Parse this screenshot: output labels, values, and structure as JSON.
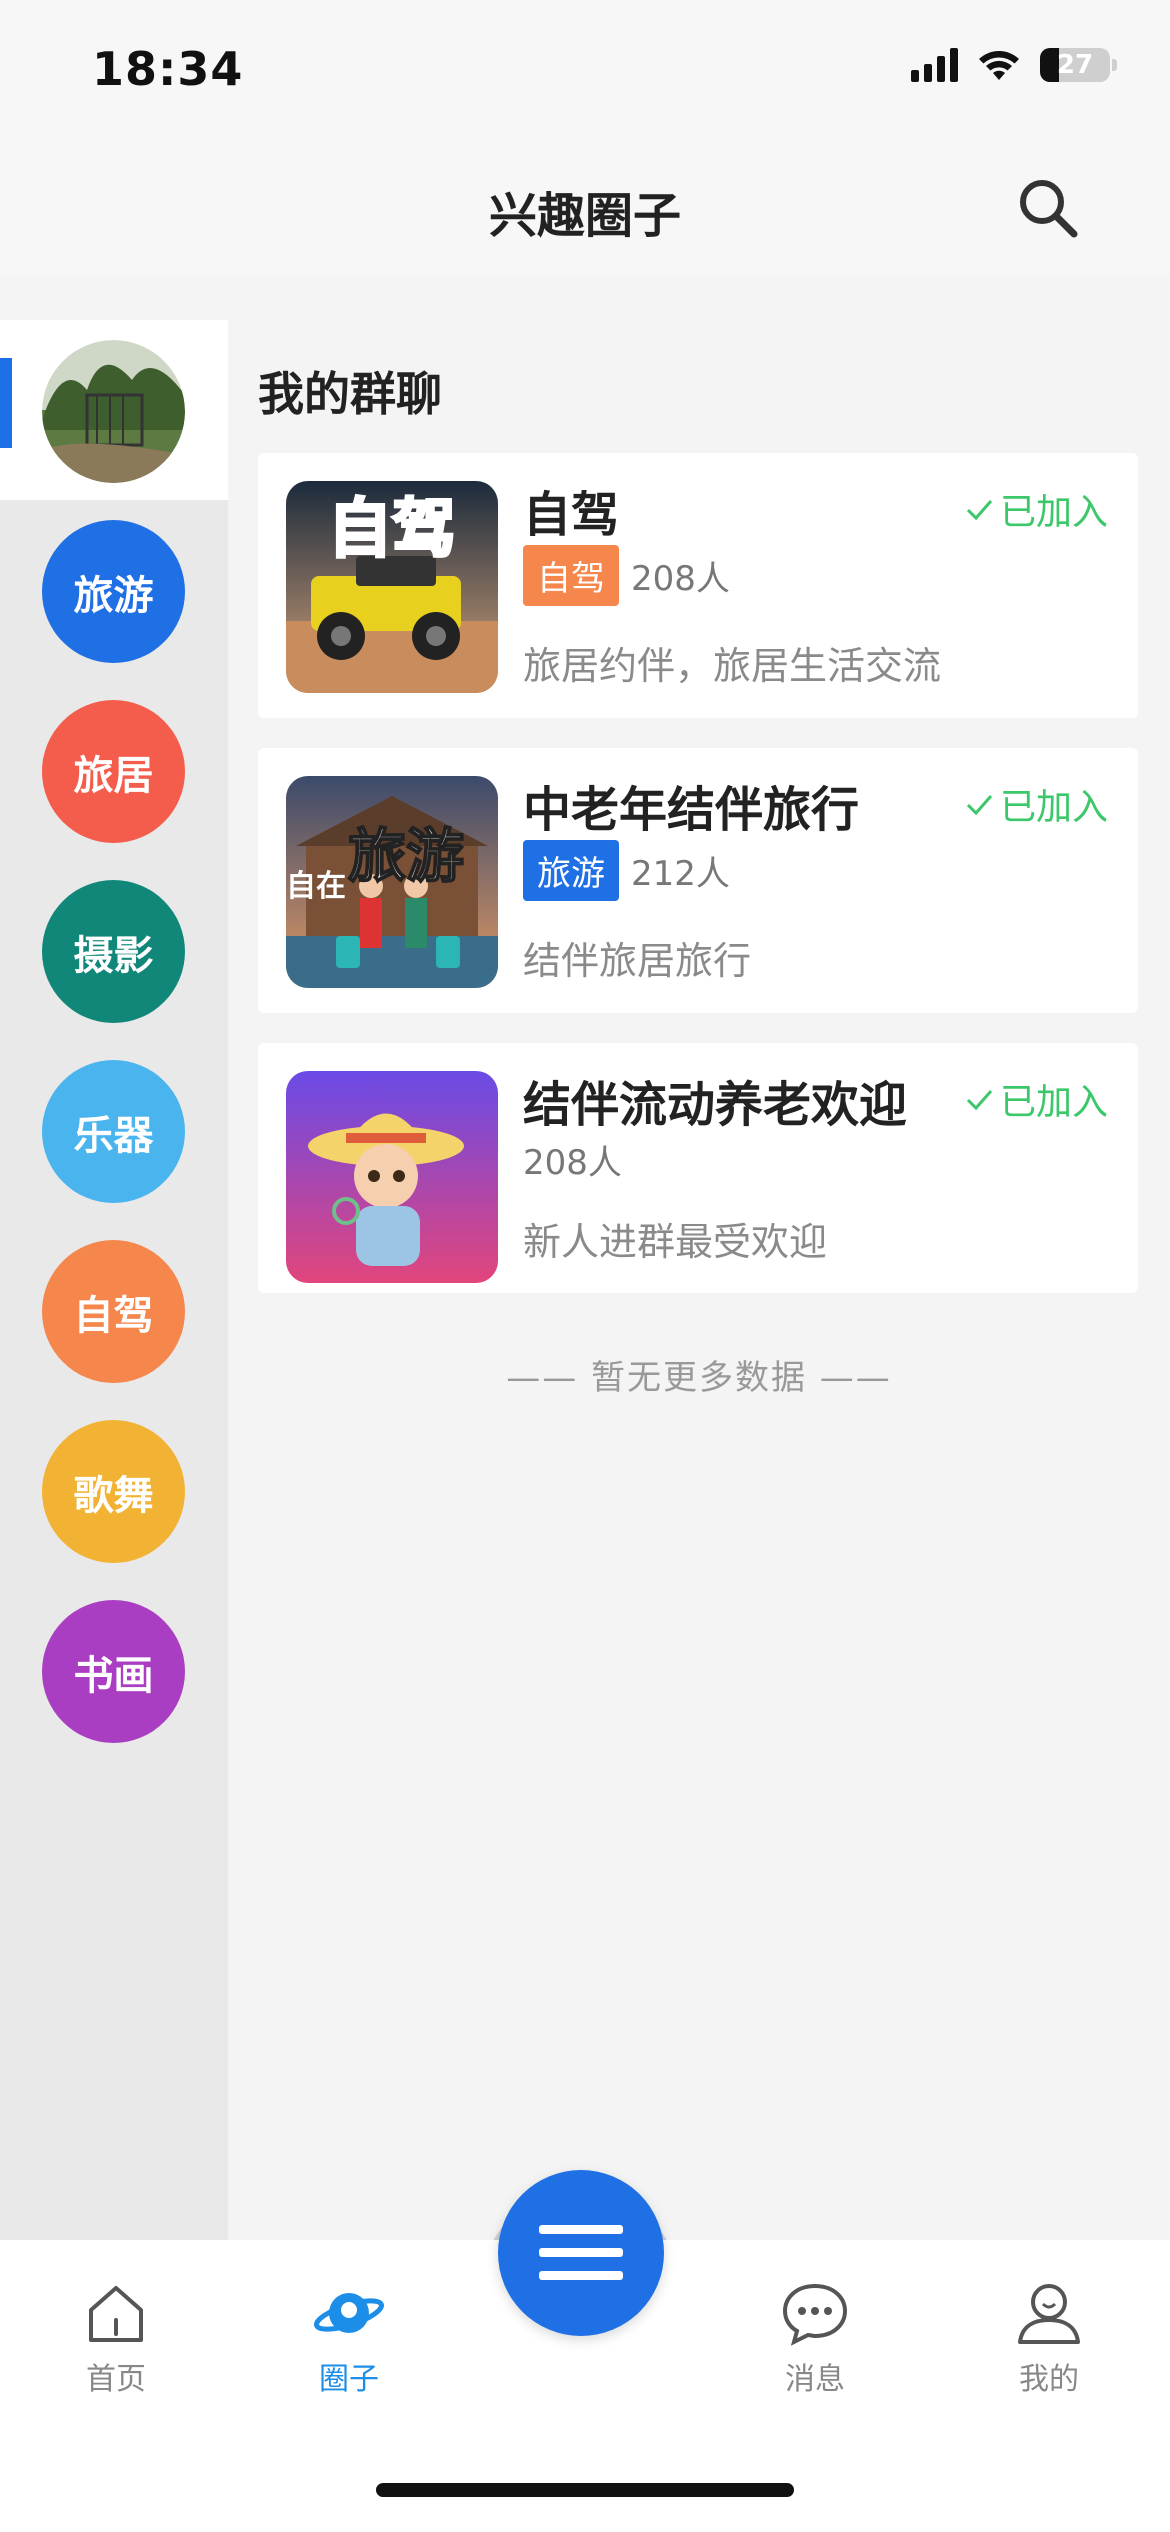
{
  "status": {
    "time": "18:34",
    "battery": "27"
  },
  "header": {
    "title": "兴趣圈子"
  },
  "sidebar": {
    "items": [
      {
        "label": "",
        "color": "#6b8b5a",
        "is_avatar": true
      },
      {
        "label": "旅游",
        "color": "#1f6fe5"
      },
      {
        "label": "旅居",
        "color": "#f45d4c"
      },
      {
        "label": "摄影",
        "color": "#11877a"
      },
      {
        "label": "乐器",
        "color": "#4ab4ee"
      },
      {
        "label": "自驾",
        "color": "#f5874d"
      },
      {
        "label": "歌舞",
        "color": "#f2b234"
      },
      {
        "label": "书画",
        "color": "#a93ec2"
      }
    ]
  },
  "main": {
    "section_title": "我的群聊",
    "groups": [
      {
        "name": "自驾",
        "joined": "已加入",
        "tag": "自驾",
        "tag_color": "#f5874d",
        "members": "208人",
        "desc": "旅居约伴，旅居生活交流"
      },
      {
        "name": "中老年结伴旅行",
        "joined": "已加入",
        "tag": "旅游",
        "tag_color": "#1f6fe5",
        "members": "212人",
        "desc": "结伴旅居旅行"
      },
      {
        "name": "结伴流动养老欢迎",
        "joined": "已加入",
        "tag": "",
        "members": "208人",
        "desc": "新人进群最受欢迎"
      }
    ],
    "thumb_texts": {
      "g1": "自驾",
      "g2": "旅游",
      "g2_small": "自在"
    },
    "no_more": "—— 暂无更多数据 ——"
  },
  "tabbar": {
    "items": [
      {
        "label": "首页"
      },
      {
        "label": "圈子"
      },
      {
        "label": "消息"
      },
      {
        "label": "我的"
      }
    ]
  }
}
